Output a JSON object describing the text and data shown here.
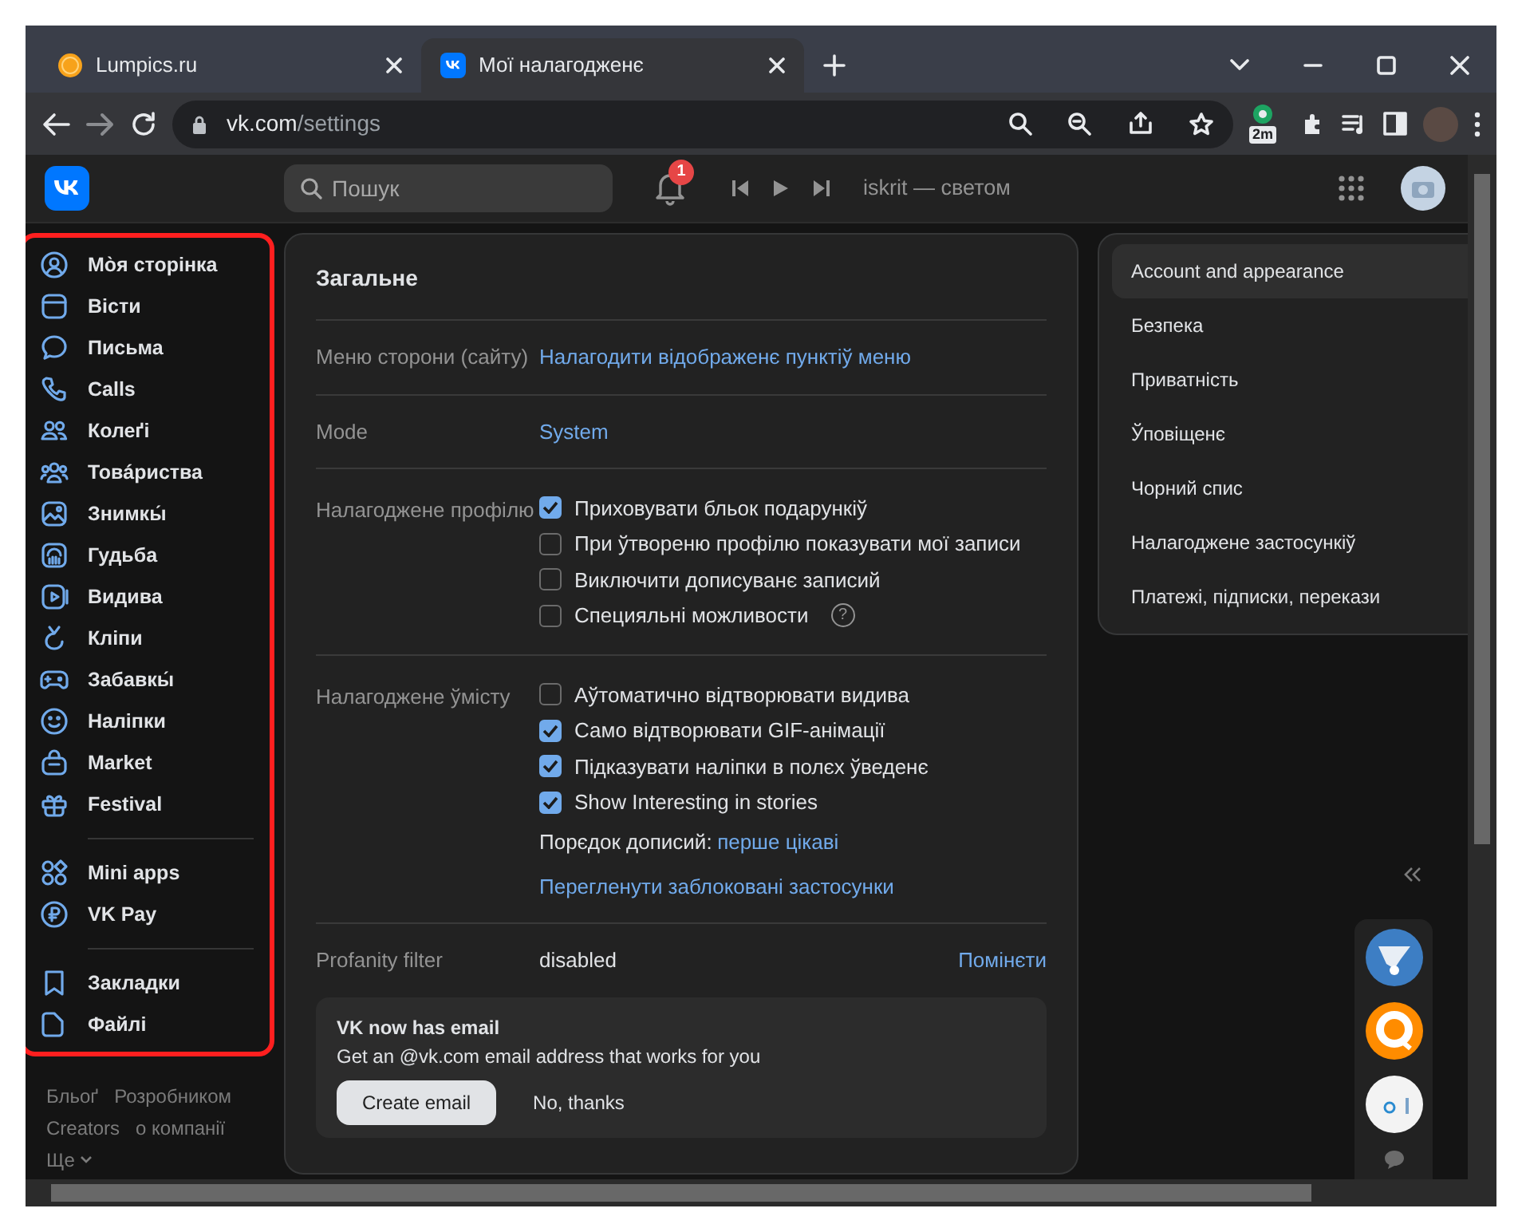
{
  "browser": {
    "tabs": [
      {
        "title": "Lumpics.ru",
        "selected": false
      },
      {
        "title": "Мої налагодженє",
        "selected": true
      }
    ],
    "url": {
      "host": "vk.com",
      "path": "/settings"
    },
    "extension_badge": "2m"
  },
  "header": {
    "search": {
      "placeholder": "Пошук"
    },
    "notification_count": "1",
    "now_playing": "iskrit — светом"
  },
  "sidebar": {
    "groups": [
      [
        {
          "label": "Мо̀я сторінка"
        },
        {
          "label": "Вісти"
        },
        {
          "label": "Письма"
        },
        {
          "label": "Calls"
        },
        {
          "label": "Колеґі"
        },
        {
          "label": "Товáриства"
        },
        {
          "label": "Знимкы́"
        },
        {
          "label": "Гудьба"
        },
        {
          "label": "Видива"
        },
        {
          "label": "Кліпи"
        },
        {
          "label": "Забавкы́"
        },
        {
          "label": "Наліпки"
        },
        {
          "label": "Market"
        },
        {
          "label": "Festival"
        }
      ],
      [
        {
          "label": "Mini apps"
        },
        {
          "label": "VK Pay"
        }
      ],
      [
        {
          "label": "Закладки"
        },
        {
          "label": "Файлі"
        }
      ]
    ],
    "footer_links": [
      "Бльоґ",
      "Розробником",
      "Creators",
      "о компанії",
      "Ще"
    ]
  },
  "settings": {
    "title": "Загальне",
    "rows": [
      {
        "kind": "link",
        "label": "Меню сторони (сайту)",
        "value": "Налагодити відображенє пунктіў меню"
      },
      {
        "kind": "link",
        "label": "Mode",
        "value": "System"
      },
      {
        "kind": "checks",
        "label": "Налагоджене профілю",
        "options": [
          {
            "text": "Приховувати бльок подарункіў",
            "checked": true
          },
          {
            "text": "При ўтвореню профілю показувати мої записи",
            "checked": false
          },
          {
            "text": "Виключити дописуванє записий",
            "checked": false
          },
          {
            "text": "Специяльні можливости",
            "checked": false,
            "help_label": "?"
          }
        ]
      },
      {
        "kind": "checks",
        "label": "Налагоджене ўмісту",
        "options": [
          {
            "text": "Аўтоматично відтворювати видива",
            "checked": false
          },
          {
            "text": "Само відтворювати GIF-анімації",
            "checked": true
          },
          {
            "text": "Підказувати наліпки в полєх ўведенє",
            "checked": true
          },
          {
            "text": "Show Interesting in stories",
            "checked": true
          }
        ],
        "order_label": "Порєдок дописий:",
        "order_value": "перше цікаві",
        "extra_link": "Перегленути заблоковані застосунки"
      },
      {
        "kind": "value",
        "label": "Profanity filter",
        "value": "disabled",
        "action": "Помінєти"
      }
    ],
    "promo": {
      "title": "VK now has email",
      "text": "Get an @vk.com email address that works for you",
      "primary": "Create email",
      "secondary": "No, thanks"
    }
  },
  "menu": [
    {
      "label": "Account and appearance",
      "selected": true
    },
    {
      "label": "Безпека",
      "selected": false
    },
    {
      "label": "Приватність",
      "selected": false
    },
    {
      "label": "Ўповіщенє",
      "selected": false
    },
    {
      "label": "Чорний спис",
      "selected": false
    },
    {
      "label": "Налагоджене застосункіў",
      "selected": false
    },
    {
      "label": "Платежі, підписки, перекази",
      "selected": false
    }
  ]
}
